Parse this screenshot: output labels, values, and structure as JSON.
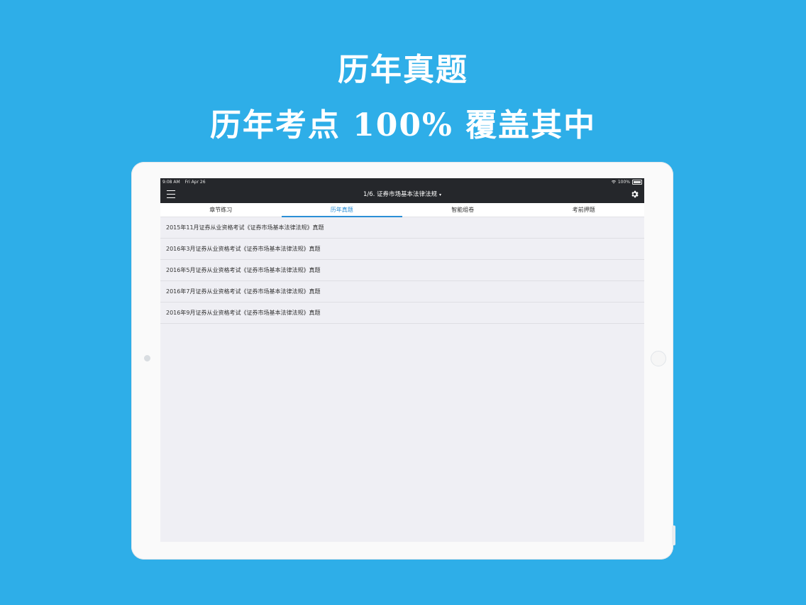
{
  "promo": {
    "headline": "历年真题",
    "subheadline": "历年考点 100% 覆盖其中"
  },
  "status_bar": {
    "time": "9:08 AM",
    "date": "Fri Apr 26",
    "battery": "100%"
  },
  "nav": {
    "title": "1/6. 证券市场基本法律法规",
    "title_caret": "▾"
  },
  "tabs": [
    {
      "label": "章节练习",
      "active": false
    },
    {
      "label": "历年真题",
      "active": true
    },
    {
      "label": "智能组卷",
      "active": false
    },
    {
      "label": "考前押题",
      "active": false
    }
  ],
  "exam_list": [
    {
      "label": "2015年11月证券从业资格考试《证券市场基本法律法规》真题"
    },
    {
      "label": "2016年3月证券从业资格考试《证券市场基本法律法规》真题"
    },
    {
      "label": "2016年5月证券从业资格考试《证券市场基本法律法规》真题"
    },
    {
      "label": "2016年7月证券从业资格考试《证券市场基本法律法规》真题"
    },
    {
      "label": "2016年9月证券从业资格考试《证券市场基本法律法规》真题"
    }
  ],
  "colors": {
    "background": "#2eaee8",
    "nav_bar": "#25272b",
    "accent": "#2b8fd6"
  }
}
